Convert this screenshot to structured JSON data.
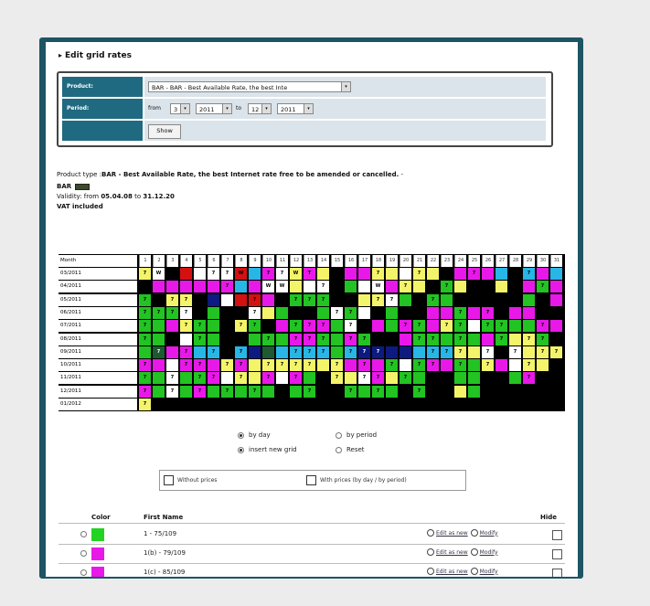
{
  "page": {
    "title": "Edit grid rates"
  },
  "form": {
    "product_label": "Product:",
    "product_value": "BAR - BAR - Best Available Rate, the best Inte",
    "period_label": "Period:",
    "from_label": "from",
    "from_month": "3",
    "from_year": "2011",
    "to_label": "to",
    "to_month": "12",
    "to_year": "2011",
    "show_button": "Show"
  },
  "info": {
    "product_type_label": "Product type :",
    "product_type_value": "BAR - Best Available Rate, the best Internet rate free to be amended or cancelled.",
    "product_type_suffix": " -",
    "code": "BAR",
    "validity_label": "Validity: from",
    "validity_from": "05.04.08",
    "validity_to_label": "to",
    "validity_to": "31.12.20",
    "vat": "VAT included"
  },
  "grid": {
    "header_label": "Month",
    "days": [
      "1",
      "2",
      "3",
      "4",
      "5",
      "6",
      "7",
      "8",
      "9",
      "10",
      "11",
      "12",
      "13",
      "14",
      "15",
      "16",
      "17",
      "18",
      "19",
      "20",
      "21",
      "22",
      "23",
      "24",
      "25",
      "26",
      "27",
      "28",
      "29",
      "30",
      "31"
    ],
    "months": [
      "03/2011",
      "04/2011",
      "05/2011",
      "06/2011",
      "07/2011",
      "08/2011",
      "09/2011",
      "10/2011",
      "11/2011",
      "12/2011",
      "01/2012"
    ],
    "colors": {
      "y": "#f4f46a",
      "g": "#22c322",
      "m": "#e818e8",
      "c": "#27b6e6",
      "b": "#0d1a80",
      "r": "#d41010",
      "w": "#ffffff",
      "d": "#1d5a32",
      "k": "#000000"
    },
    "rows": [
      "ywkrwwwrcmwymykmmyywyykmmmckcmc",
      "kmmmmmmcmwwywwkgwwmyykgykkykmgm",
      "gkyykbwrrmkgggkkyywgkggkkkkkgkm",
      "gggwkgkkwygkkgwgwkgkkmmgmmkmmkk",
      "ggmyggkygkmgmmgwkmgmgmygwggggmm",
      "ggkwggkkgggmmggmgkkmgggggmgyygk",
      "gdmmcckcbdccccgcbbbbcccyywkwyyy",
      "mmwmmmymyyyyyyymmmgwgmmggymwyyk",
      "ggwggmwyymwmgkyywmyggkkggkkgmkk",
      "mgwgmgggggkggkkggggkgkkygkkkkkk",
      "ykkkkkkkkkkkkkkkkkkkkkkkkkkkkkk"
    ],
    "labels": [
      "7WK  77W 77WT 7  7  7   7  T7",
      "      7  WW  7   W 7  7    7 7",
      "7 777   7 7777 7 77  7 7   7 7 ",
      "77777 7 7   7 77 7  7  7 77  7 ",
      "7  77 7777 777 77  77 77 77  7 ",
      "7 7 7  7 7 777 7777 77 7  7 77 ",
      " 7 7 777   777 777   777 777 77",
      "7  77 77 7777 7 7 7 77 7 7  7  ",
      "7 7 77 7 7 7 77 77 7 7   7  7  ",
      "7 7 7 7 7 7 7  7 7 77 7   7    ",
      "7                              "
    ]
  },
  "view_options": {
    "by_day": "by day",
    "by_period": "by period",
    "insert_new_grid": "insert new grid",
    "reset": "Reset"
  },
  "price_options": {
    "without_prices": "Without prices",
    "with_prices": "With prices (by day / by period)"
  },
  "table": {
    "col_color": "Color",
    "col_first_name": "First Name",
    "col_hide": "Hide",
    "edit_label": "Edit as new",
    "modify_label": "Modify",
    "rows": [
      {
        "color": "#22d322",
        "name": "1 - 75/109"
      },
      {
        "color": "#e818e8",
        "name": "1(b) - 79/109"
      },
      {
        "color": "#e818e8",
        "name": "1(c) - 85/109"
      }
    ]
  }
}
